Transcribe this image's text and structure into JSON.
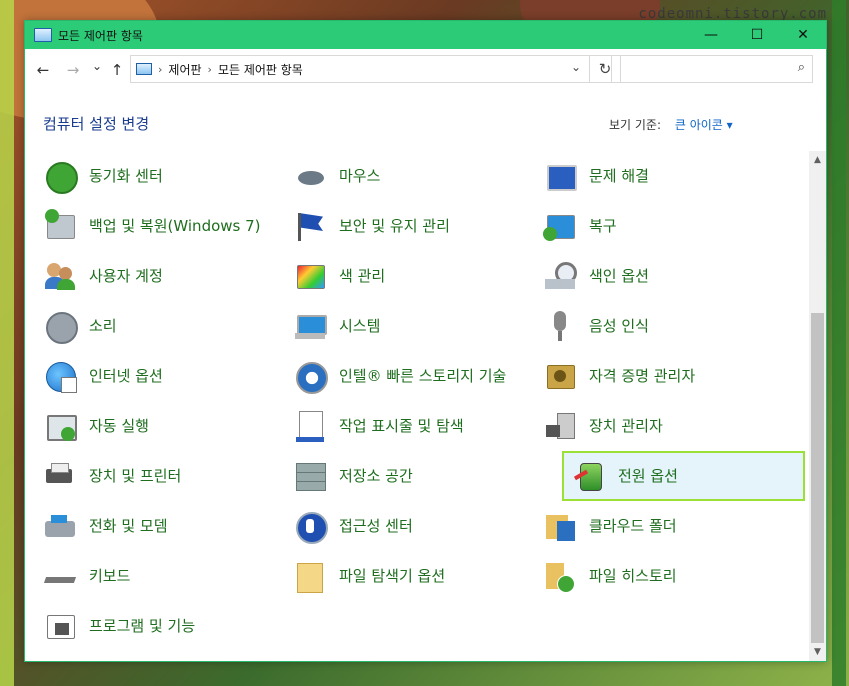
{
  "window": {
    "title": "모든 제어판 항목"
  },
  "watermark": "codeomni.tistory.com",
  "window_buttons": {
    "minimize": "—",
    "maximize": "☐",
    "close": "✕"
  },
  "nav": {
    "back": "←",
    "forward": "→",
    "recent": "⌄",
    "up": "↑",
    "refresh": "↻",
    "dropdown": "⌄"
  },
  "address": {
    "sep": "›",
    "crumbs": [
      "제어판",
      "모든 제어판 항목"
    ]
  },
  "search": {
    "placeholder": "",
    "icon": "⌕"
  },
  "heading": "컴퓨터 설정 변경",
  "view_by": {
    "label": "보기 기준:",
    "value": "큰 아이콘 ▾"
  },
  "colors": {
    "titlebar": "#2bcb77",
    "link": "#1f6e1f",
    "heading": "#1a3d8f",
    "selection_border": "#9be034"
  },
  "items": [
    [
      "동기화 센터",
      "마우스",
      "문제 해결"
    ],
    [
      "백업 및 복원(Windows 7)",
      "보안 및 유지 관리",
      "복구"
    ],
    [
      "사용자 계정",
      "색 관리",
      "색인 옵션"
    ],
    [
      "소리",
      "시스템",
      "음성 인식"
    ],
    [
      "인터넷 옵션",
      "인텔® 빠른 스토리지 기술",
      "자격 증명 관리자"
    ],
    [
      "자동 실행",
      "작업 표시줄 및 탐색",
      "장치 관리자"
    ],
    [
      "장치 및 프린터",
      "저장소 공간",
      "전원 옵션"
    ],
    [
      "전화 및 모뎀",
      "접근성 센터",
      "클라우드 폴더"
    ],
    [
      "키보드",
      "파일 탐색기 옵션",
      "파일 히스토리"
    ],
    [
      "프로그램 및 기능"
    ]
  ],
  "selected_item": "전원 옵션",
  "scroll": {
    "up": "▲",
    "down": "▼"
  }
}
